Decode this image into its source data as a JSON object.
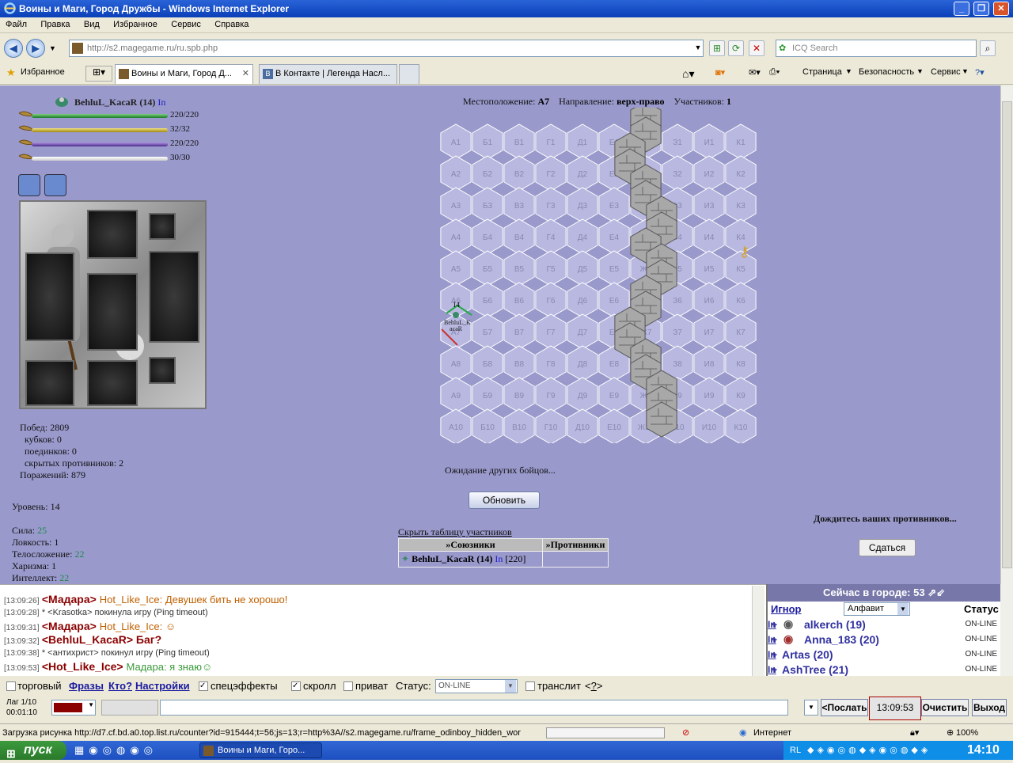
{
  "window": {
    "title": "Воины и Маги, Город Дружбы - Windows Internet Explorer"
  },
  "menu": [
    "Файл",
    "Правка",
    "Вид",
    "Избранное",
    "Сервис",
    "Справка"
  ],
  "address": {
    "url": "http://s2.magegame.ru/ru.spb.php",
    "search_placeholder": "ICQ Search"
  },
  "tabs": {
    "favorites": "Избранное",
    "items": [
      "Воины и Маги, Город Д...",
      "В Контакте | Легенда Насл..."
    ],
    "tools": [
      "Страница",
      "Безопасность",
      "Сервис"
    ]
  },
  "character": {
    "name": "BehluL_KacaR (14)",
    "info": "In",
    "hp": "220/220",
    "mp": "32/32",
    "energy": "220/220",
    "stamina": "30/30"
  },
  "stats": {
    "wins": "Побед: 2809",
    "cups": "кубков: 0",
    "duels": "поединков: 0",
    "hidden": "скрытых противников: 2",
    "losses": "Поражений: 879",
    "level": "Уровень: 14",
    "str_l": "Сила: ",
    "str": "25",
    "agi": "Ловкость: 1",
    "con_l": "Телосложение: ",
    "con": "22",
    "cha": "Харизма: 1",
    "int_l": "Интеллект: ",
    "int": "22"
  },
  "battle": {
    "loc_l": "Местоположение: ",
    "loc": "А7",
    "dir_l": "Направление: ",
    "dir": "верх-право",
    "part_l": "Участников: ",
    "part": "1",
    "waiting": "Ожидание других бойцов...",
    "refresh": "Обновить",
    "wait_opp": "Дождитесь ваших противников...",
    "surrender": "Сдаться",
    "hide_table": "Скрыть таблицу участников",
    "allies_h": "»Союзники",
    "enemies_h": "»Противники",
    "ally_name": "BehluL_KacaR (14)",
    "ally_in": "In",
    "ally_hp": "[220]",
    "unit_level": "14",
    "unit_label1": "BehluL_K",
    "unit_label2": "acaR"
  },
  "hex": {
    "cols": [
      "А",
      "Б",
      "В",
      "Г",
      "Д",
      "Е",
      "Ж",
      "З",
      "И",
      "К"
    ],
    "rows": 10
  },
  "chat": [
    {
      "time": "[13:09:26]",
      "nick": "Мадара",
      "msg": "Hot_Like_Ice: Девушек бить не хорошо!"
    },
    {
      "time": "[13:09:28]",
      "sys": "* <Krasotka> покинула игру (Ping timeout)"
    },
    {
      "time": "[13:09:31]",
      "nick": "Мадара",
      "msg": "Hot_Like_Ice: ☺"
    },
    {
      "time": "[13:09:32]",
      "nick": "BehluL_KacaR",
      "msg": "Баг?"
    },
    {
      "time": "[13:09:38]",
      "sys": "* <антихрист> покинул игру (Ping timeout)"
    },
    {
      "time": "[13:09:53]",
      "nick": "Hot_Like_Ice",
      "msg": "Мадара: я знаю☺"
    }
  ],
  "online": {
    "title": "Сейчас в городе: 53",
    "ignore": "Игнор",
    "sort": "Алфавит",
    "status_h": "Статус",
    "users": [
      {
        "name": "alkerch (19)",
        "st": "ON-LINE"
      },
      {
        "name": "Anna_183 (20)",
        "st": "ON-LINE"
      },
      {
        "name": "Artas (20)",
        "st": "ON-LINE"
      },
      {
        "name": "AshTree (21)",
        "st": "ON-LINE"
      }
    ]
  },
  "controls": {
    "trade": "торговый",
    "phrases": "Фразы",
    "who": "Кто?",
    "settings": "Настройки",
    "fx": "спецэффекты",
    "scroll": "скролл",
    "private": "приват",
    "status_l": "Статус:",
    "status": "ON-LINE",
    "translit": "транслит",
    "lag": "Лаг 1/10",
    "timer": "00:01:10",
    "send": "<Послать",
    "clock": "13:09:53",
    "clear": "Очистить",
    "exit": "Выход"
  },
  "statusbar": {
    "text": "Загрузка рисунка http://d7.cf.bd.a0.top.list.ru/counter?id=915444;t=56;js=13;r=http%3A//s2.magegame.ru/frame_odinboy_hidden_wor",
    "zone": "Интернет",
    "zoom": "100%"
  },
  "taskbar": {
    "start": "пуск",
    "task": "Воины и Маги, Горо...",
    "lang": "RL",
    "time": "14:10"
  }
}
